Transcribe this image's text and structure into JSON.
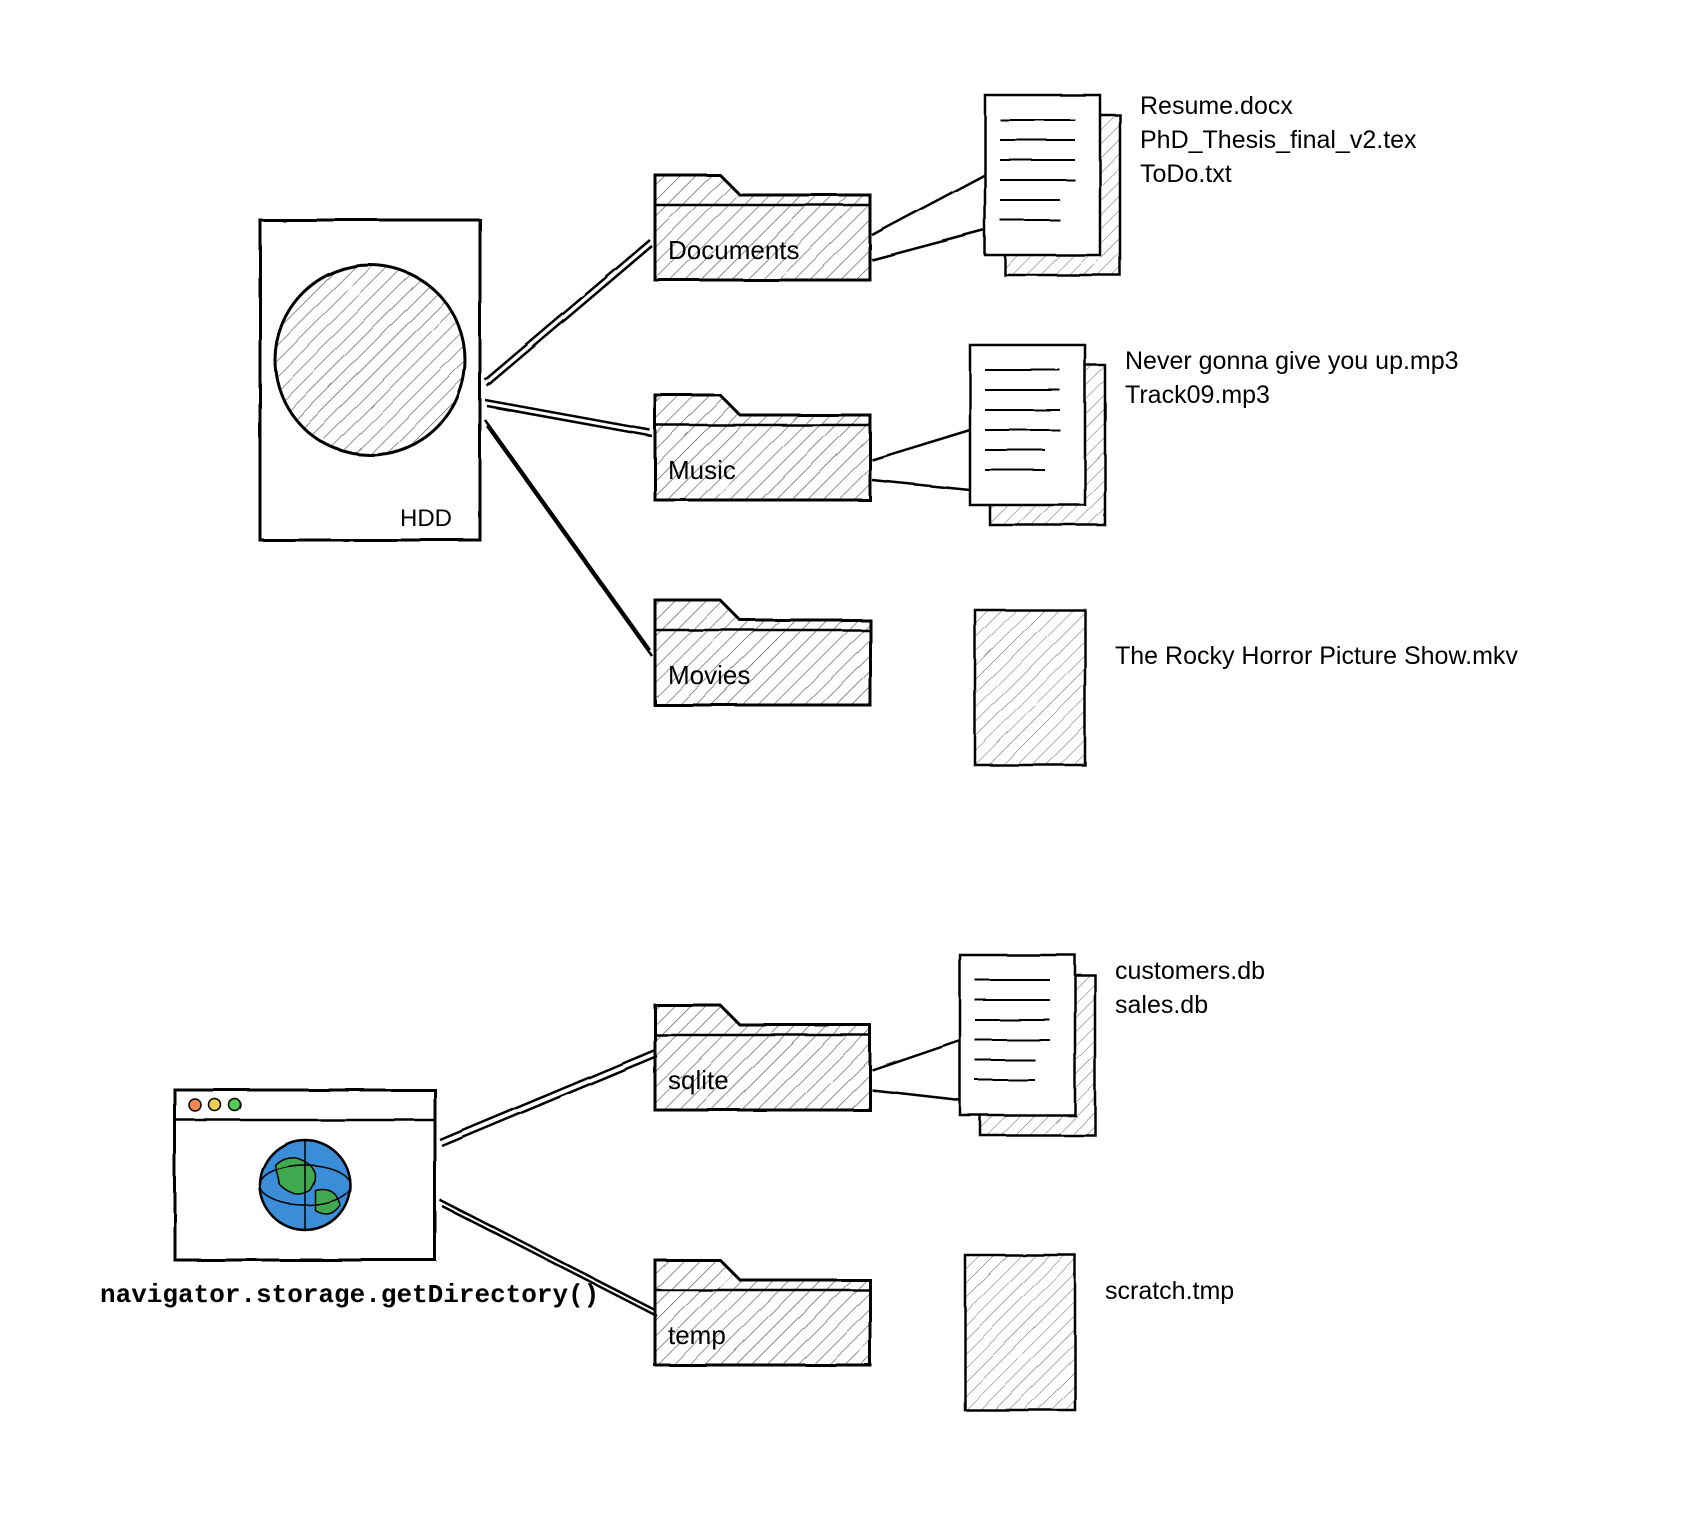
{
  "disk": {
    "label": "HDD"
  },
  "api": {
    "label": "navigator.storage.getDirectory()"
  },
  "folders": {
    "documents": {
      "label": "Documents",
      "files": [
        "Resume.docx",
        "PhD_Thesis_final_v2.tex",
        "ToDo.txt"
      ]
    },
    "music": {
      "label": "Music",
      "files": [
        "Never gonna give you up.mp3",
        "Track09.mp3"
      ]
    },
    "movies": {
      "label": "Movies",
      "files": [
        "The Rocky Horror Picture Show.mkv"
      ]
    },
    "sqlite": {
      "label": "sqlite",
      "files": [
        "customers.db",
        "sales.db"
      ]
    },
    "temp": {
      "label": "temp",
      "files": [
        "scratch.tmp"
      ]
    }
  }
}
